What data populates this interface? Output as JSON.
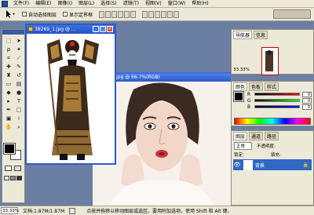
{
  "menubar": {
    "items": [
      "文件(F)",
      "编辑(E)",
      "图像(I)",
      "图层(L)",
      "选择(S)",
      "滤镜(T)",
      "视图(V)",
      "窗口(W)",
      "帮助(H)"
    ]
  },
  "options": {
    "auto_select": "自动选择图层",
    "show_bounds": "显示定界框"
  },
  "doc1": {
    "title": "38269_1.jpg @ ..."
  },
  "doc2": {
    "title": "jpg @ 66.7%(RGB)"
  },
  "navigator": {
    "tabs": [
      "导航器",
      "信息"
    ],
    "zoom": "33.33%"
  },
  "color_panel": {
    "tabs": [
      "颜色",
      "色板",
      "样式"
    ],
    "channels": [
      {
        "label": "R",
        "value": "0"
      },
      {
        "label": "G",
        "value": "0"
      },
      {
        "label": "B",
        "value": "0"
      }
    ]
  },
  "layers": {
    "tabs": [
      "图层",
      "通道",
      "路径"
    ],
    "mode": "正常",
    "opacity_label": "不透明度:",
    "lock_label": "锁定:",
    "fill_label": "填充:",
    "layer_name": "背景"
  },
  "status": {
    "zoom": "33.33%",
    "doc": "文档:1.87M/1.87M",
    "hint": "点按并拖移以移动图层或选区。要用附加选项，使用 Shift 和 Alt 键。"
  },
  "colors": {
    "titlebar": "#2c5ac8",
    "panel_title": "#5f82c7",
    "layer_selected": "#3168c6",
    "workspace": "#6b7fa3"
  }
}
